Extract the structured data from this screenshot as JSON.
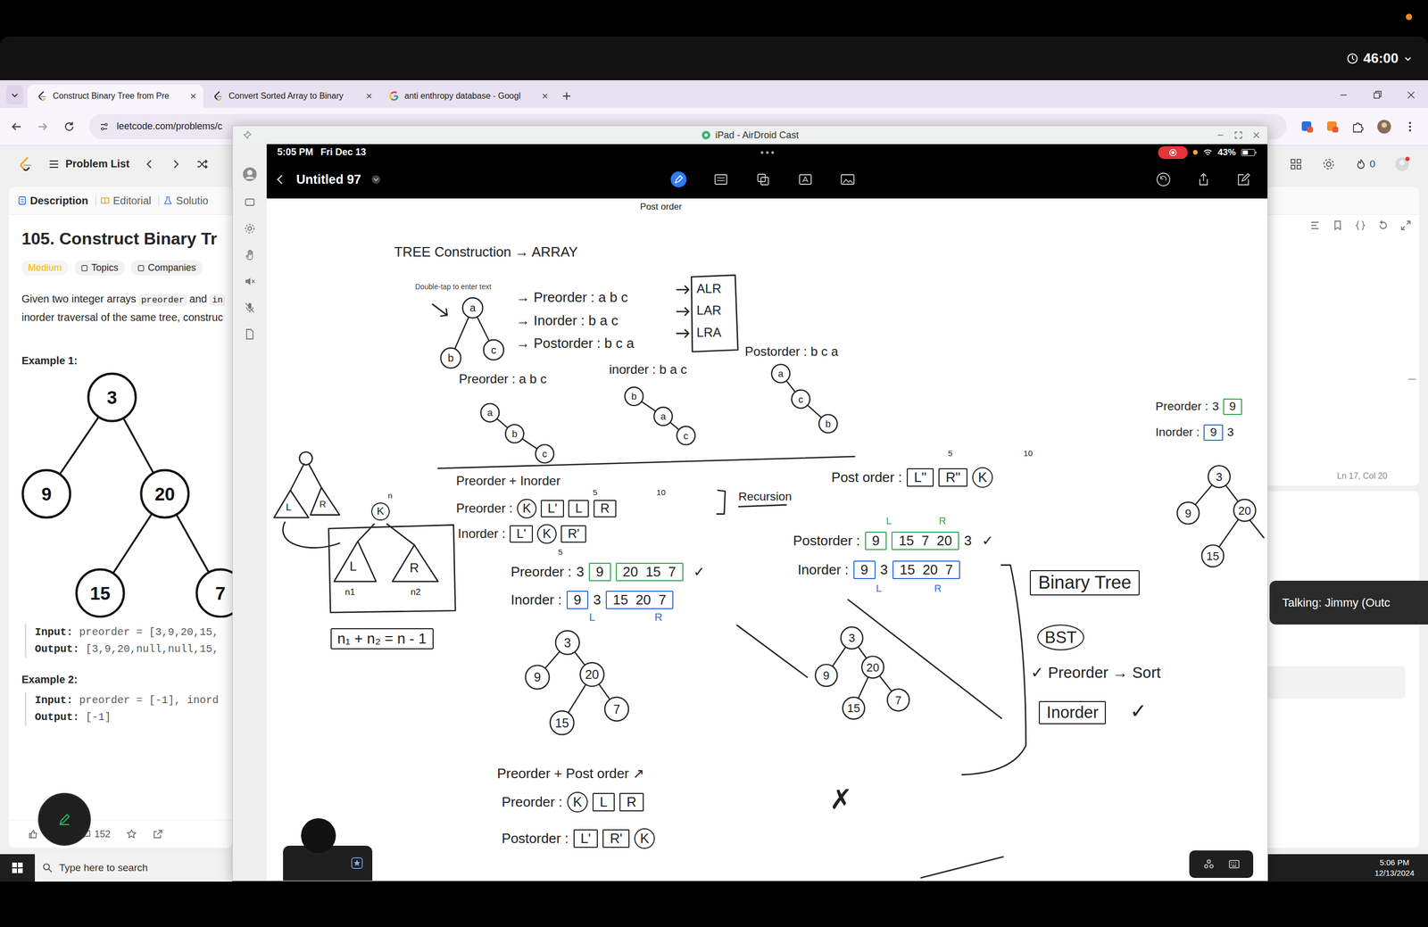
{
  "capture": {
    "timer": "46:00"
  },
  "browser": {
    "tabs": [
      {
        "label": "Construct Binary Tree from Pre",
        "selected": true,
        "kind": "leetcode"
      },
      {
        "label": "Convert Sorted Array to Binary",
        "selected": false,
        "kind": "leetcode"
      },
      {
        "label": "anti enthropy database - Googl",
        "selected": false,
        "kind": "google"
      }
    ],
    "url": "leetcode.com/problems/c"
  },
  "leetcode": {
    "toolbar": {
      "problem_list": "Problem List",
      "streak": "0"
    },
    "panel_tabs": [
      {
        "label": "Description",
        "selected": true
      },
      {
        "label": "Editorial",
        "selected": false
      },
      {
        "label": "Solutio",
        "selected": false
      }
    ],
    "title": "105. Construct Binary Tr",
    "difficulty": "Medium",
    "tags": [
      "Topics",
      "Companies"
    ],
    "description": [
      [
        {
          "text": "Given two integer arrays ",
          "code": false
        },
        {
          "text": "preorder",
          "code": true
        },
        {
          "text": " and ",
          "code": false
        },
        {
          "text": "in",
          "code": true
        }
      ],
      [
        {
          "text": "inorder traversal of the same tree, construc",
          "code": false
        }
      ]
    ],
    "input_label": "Input:",
    "output_label": "Output:",
    "examples": [
      {
        "title": "Example 1:",
        "tree": [
          "3",
          "9",
          "20",
          "15",
          "7"
        ],
        "input": "preorder = [3,9,20,15,",
        "output": "[3,9,20,null,null,15,"
      },
      {
        "title": "Example 2:",
        "tree": [],
        "input": "preorder = [-1], inord",
        "output": "[-1]"
      }
    ],
    "comments": "152",
    "editor_status": "Ln 17, Col 20"
  },
  "airdroid": {
    "title": "iPad - AirDroid Cast"
  },
  "ipad": {
    "time": "5:05 PM",
    "date": "Fri Dec 13",
    "battery": "43%",
    "recording": true,
    "note_title": "Untitled 97"
  },
  "notes": [
    {
      "text": "Post order",
      "kind": "text",
      "color": "#222222"
    },
    {
      "text": "TREE Construction → ARRAY",
      "kind": "text",
      "color": "#222222"
    },
    {
      "text": "Double-tap to enter text",
      "kind": "hint",
      "color": "#444444"
    },
    {
      "text": "→ Preorder : a b c",
      "kind": "text",
      "color": "#222222"
    },
    {
      "text": "→ Inorder : b a c",
      "kind": "text",
      "color": "#222222"
    },
    {
      "text": "→ Postorder : b c a",
      "kind": "text",
      "color": "#222222"
    },
    {
      "text": "ALR",
      "kind": "text",
      "color": "#222222"
    },
    {
      "text": "LAR",
      "kind": "text",
      "color": "#222222"
    },
    {
      "text": "LRA",
      "kind": "text",
      "color": "#222222"
    },
    {
      "text": "Preorder : a b c",
      "kind": "text",
      "color": "#222222"
    },
    {
      "text": "inorder : b a c",
      "kind": "text",
      "color": "#222222"
    },
    {
      "text": "Postorder : b c a",
      "kind": "text",
      "color": "#222222"
    },
    {
      "text": "Preorder + Inorder",
      "kind": "text",
      "color": "#222222"
    },
    {
      "text": "Recursion",
      "kind": "text",
      "color": "#222222"
    },
    {
      "text": "n₁ + n₂ = n - 1",
      "kind": "boxed",
      "color": "#222222"
    },
    {
      "text": "K",
      "kind": "circled",
      "color": "#222222"
    },
    {
      "text": "n",
      "kind": "text",
      "color": "#222222"
    },
    {
      "text": "L",
      "kind": "text",
      "color": "#222222"
    },
    {
      "text": "R",
      "kind": "text",
      "color": "#222222"
    },
    {
      "text": "n1",
      "kind": "text",
      "color": "#222222"
    },
    {
      "text": "n2",
      "kind": "text",
      "color": "#222222"
    },
    {
      "text": "L",
      "kind": "text",
      "color": "#222222"
    },
    {
      "text": "R",
      "kind": "text",
      "color": "#222222"
    },
    {
      "text": "5",
      "kind": "text",
      "color": "#222222"
    },
    {
      "text": "10",
      "kind": "text",
      "color": "#222222"
    },
    {
      "text": "5",
      "kind": "text",
      "color": "#222222"
    },
    {
      "text": "L",
      "kind": "text",
      "color": "#2f6fd6"
    },
    {
      "text": "R",
      "kind": "text",
      "color": "#2f6fd6"
    },
    {
      "text": "5",
      "kind": "text",
      "color": "#222222"
    },
    {
      "text": "10",
      "kind": "text",
      "color": "#222222"
    },
    {
      "text": "L",
      "kind": "text",
      "color": "#3aa655"
    },
    {
      "text": "R",
      "kind": "text",
      "color": "#3aa655"
    },
    {
      "text": "L",
      "kind": "text",
      "color": "#2f6fd6"
    },
    {
      "text": "R",
      "kind": "text",
      "color": "#2f6fd6"
    },
    {
      "text": "Binary Tree",
      "kind": "boxed",
      "color": "#222222"
    },
    {
      "text": "BST",
      "kind": "circled",
      "color": "#222222"
    },
    {
      "text": "✓ Preorder → Sort",
      "kind": "text",
      "color": "#222222"
    },
    {
      "text": "Inorder",
      "kind": "boxed",
      "color": "#222222"
    },
    {
      "text": "✓",
      "kind": "text",
      "color": "#222222"
    },
    {
      "text": "Preorder + Post order ↗",
      "kind": "text",
      "color": "#222222"
    },
    {
      "text": "✗",
      "kind": "text",
      "color": "#222222"
    }
  ],
  "note_arrays": [
    {
      "label": "Preorder :",
      "cells": [
        {
          "text": "K",
          "kind": "circle",
          "color": "#222222"
        },
        {
          "text": "L'",
          "kind": "box",
          "color": "#222222"
        },
        {
          "text": "L",
          "kind": "box",
          "color": "#222222"
        },
        {
          "text": "R",
          "kind": "box",
          "color": "#222222"
        }
      ]
    },
    {
      "label": "Inorder :",
      "cells": [
        {
          "text": "L'",
          "kind": "box",
          "color": "#222222"
        },
        {
          "text": "K",
          "kind": "circle",
          "color": "#222222"
        },
        {
          "text": "R'",
          "kind": "box",
          "color": "#222222"
        }
      ]
    },
    {
      "label": "Post order :",
      "cells": [
        {
          "text": "L\"",
          "kind": "box",
          "color": "#222222"
        },
        {
          "text": "R\"",
          "kind": "box",
          "color": "#222222"
        },
        {
          "text": "K",
          "kind": "circle",
          "color": "#222222"
        }
      ]
    },
    {
      "label": "Preorder :",
      "cells": [
        {
          "text": "3",
          "kind": "plain"
        },
        {
          "text": "9",
          "kind": "box",
          "color": "#3aa655"
        },
        {
          "text": "20  15  7",
          "kind": "box",
          "color": "#3aa655"
        }
      ],
      "mark": "✓"
    },
    {
      "label": "Inorder :",
      "cells": [
        {
          "text": "9",
          "kind": "box",
          "color": "#2f6fd6"
        },
        {
          "text": "3",
          "kind": "plain"
        },
        {
          "text": "15  20  7",
          "kind": "box",
          "color": "#2f6fd6"
        }
      ]
    },
    {
      "label": "Postorder :",
      "cells": [
        {
          "text": "9",
          "kind": "box",
          "color": "#3aa655"
        },
        {
          "text": "15  7  20",
          "kind": "box",
          "color": "#3aa655"
        },
        {
          "text": "3",
          "kind": "plain"
        }
      ],
      "mark": "✓"
    },
    {
      "label": "Inorder :",
      "cells": [
        {
          "text": "9",
          "kind": "box",
          "color": "#2f6fd6"
        },
        {
          "text": "3",
          "kind": "plain"
        },
        {
          "text": "15  20  7",
          "kind": "box",
          "color": "#2f6fd6"
        }
      ]
    },
    {
      "label": "Preorder :",
      "cells": [
        {
          "text": "K",
          "kind": "circle",
          "color": "#222222"
        },
        {
          "text": "L",
          "kind": "box",
          "color": "#222222"
        },
        {
          "text": "R",
          "kind": "box",
          "color": "#222222"
        }
      ]
    },
    {
      "label": "Postorder :",
      "cells": [
        {
          "text": "L'",
          "kind": "box",
          "color": "#222222"
        },
        {
          "text": "R'",
          "kind": "box",
          "color": "#222222"
        },
        {
          "text": "K",
          "kind": "circle",
          "color": "#222222"
        }
      ]
    },
    {
      "label": "Preorder :",
      "cells": [
        {
          "text": "3",
          "kind": "plain"
        },
        {
          "text": "9",
          "kind": "box",
          "color": "#3aa655"
        }
      ]
    },
    {
      "label": "Inorder :",
      "cells": [
        {
          "text": "9",
          "kind": "box",
          "color": "#2f6fd6"
        },
        {
          "text": "3",
          "kind": "plain"
        }
      ]
    }
  ],
  "note_trees": [
    {
      "nodes": [
        "a",
        "b",
        "c"
      ]
    },
    {
      "nodes": [
        "a",
        "b",
        "c"
      ]
    },
    {
      "nodes": [
        "b",
        "a",
        "c"
      ]
    },
    {
      "nodes": [
        "a",
        "c",
        "b"
      ]
    },
    {
      "nodes": [
        "3",
        "9",
        "20",
        "15",
        "7"
      ]
    },
    {
      "nodes": [
        "3",
        "9",
        "20",
        "15",
        "7"
      ]
    },
    {
      "nodes": [
        "3",
        "9",
        "20",
        "15"
      ]
    }
  ],
  "toast": "Talking: Jimmy (Outc",
  "taskbar": {
    "search": "Type here to search",
    "time": "5:06 PM",
    "date": "12/13/2024"
  }
}
